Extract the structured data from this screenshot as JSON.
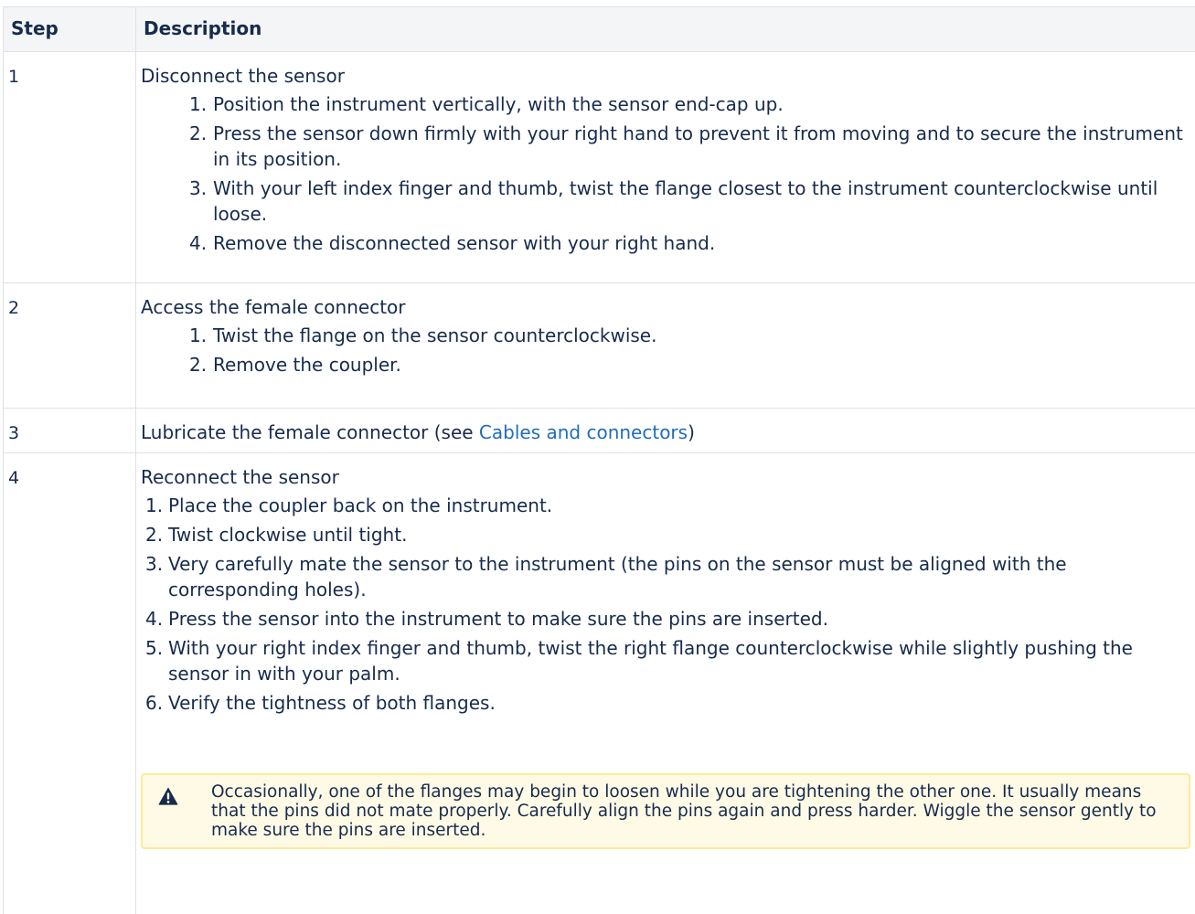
{
  "table": {
    "headers": {
      "step": "Step",
      "description": "Description"
    },
    "rows": [
      {
        "step": "1",
        "title": "Disconnect the sensor",
        "substeps": [
          "Position the instrument vertically, with the sensor end-cap up.",
          "Press the sensor down firmly with your right hand to prevent it from moving and to secure the instrument in its position.",
          "With your left index finger and thumb, twist the flange closest to the instrument counterclockwise until loose.",
          "Remove the disconnected sensor with your right hand."
        ]
      },
      {
        "step": "2",
        "title": "Access the female connector",
        "substeps": [
          "Twist the flange on the sensor counterclockwise.",
          "Remove the coupler."
        ]
      },
      {
        "step": "3",
        "title_prefix": "Lubricate the female connector (see ",
        "link_text": "Cables and connectors",
        "title_suffix": ")"
      },
      {
        "step": "4",
        "title": "Reconnect the sensor",
        "substeps": [
          "Place the coupler back on the instrument.",
          "Twist clockwise until tight.",
          "Very carefully mate the sensor to the instrument (the pins on the sensor must be aligned with the corresponding holes).",
          "Press the sensor into the instrument to make sure the pins are inserted.",
          "With your right index finger and thumb, twist the right flange counterclockwise while slightly pushing the sensor in with your palm.",
          "Verify the tightness of both flanges."
        ],
        "warning": "Occasionally, one of the flanges may begin to loosen while you are tightening the other one. It usually means that the pins did not mate properly. Carefully align the pins again and press harder. Wiggle the sensor gently to make sure the pins are inserted."
      }
    ]
  },
  "numbers": [
    "1.",
    "2.",
    "3.",
    "4.",
    "5.",
    "6."
  ],
  "colors": {
    "link": "#1f6dbf",
    "warning_bg": "#fffae6",
    "warning_border": "#ffeb99",
    "warning_icon": "#172b4d",
    "header_bg": "#f4f5f7"
  },
  "icons": {
    "warning": "warning-triangle-icon"
  }
}
